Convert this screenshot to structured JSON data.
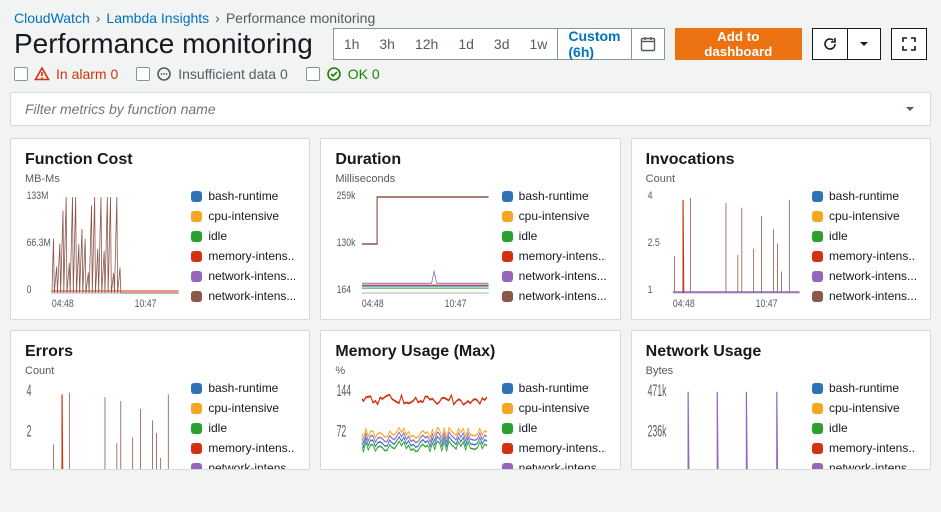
{
  "breadcrumbs": [
    "CloudWatch",
    "Lambda Insights",
    "Performance monitoring"
  ],
  "title": "Performance monitoring",
  "time_ranges": [
    "1h",
    "3h",
    "12h",
    "1d",
    "3d",
    "1w"
  ],
  "time_custom": "Custom (6h)",
  "add_dashboard": "Add to dashboard",
  "status": {
    "alarm_label": "In alarm 0",
    "insuff_label": "Insufficient data 0",
    "ok_label": "OK 0"
  },
  "filter_placeholder": "Filter metrics by function name",
  "legend_colors": {
    "bash-runtime": "#2e73b8",
    "cpu-intensive": "#f5a623",
    "idle": "#2ca02c",
    "memory-intens...": "#d13212",
    "network-intens...": "#9467bd",
    "network-intens... ": "#8c564b"
  },
  "x_ticks": [
    "04:48",
    "10:47"
  ],
  "cards": [
    {
      "title": "Function Cost",
      "unit": "MB-Ms",
      "yticks": [
        "133M",
        "66.3M",
        "0"
      ],
      "style": "spikes-brown"
    },
    {
      "title": "Duration",
      "unit": "Milliseconds",
      "yticks": [
        "259k",
        "130k",
        "164"
      ],
      "style": "step-brown-plus-low"
    },
    {
      "title": "Invocations",
      "unit": "Count",
      "yticks": [
        "4",
        "2.5",
        "1"
      ],
      "style": "spikes-brown-base"
    },
    {
      "title": "Errors",
      "unit": "Count",
      "yticks": [
        "4",
        "2",
        ""
      ],
      "style": "spikes-brown-cut"
    },
    {
      "title": "Memory Usage (Max)",
      "unit": "%",
      "yticks": [
        "144",
        "72",
        ""
      ],
      "style": "noisy-red-mid"
    },
    {
      "title": "Network Usage",
      "unit": "Bytes",
      "yticks": [
        "471k",
        "236k",
        ""
      ],
      "style": "spikes-purple"
    }
  ],
  "chart_data": [
    {
      "type": "line",
      "title": "Function Cost",
      "ylabel": "MB-Ms",
      "x_range": [
        "04:48",
        "10:47"
      ],
      "ylim": [
        0,
        133000000
      ],
      "series": [
        {
          "name": "bash-runtime",
          "note": "sparse low spikes",
          "approx_max": 5000000
        },
        {
          "name": "cpu-intensive",
          "note": "occasional spikes",
          "approx_max": 20000000
        },
        {
          "name": "idle",
          "note": "near zero"
        },
        {
          "name": "memory-intensive",
          "note": "sparse low spikes",
          "approx_max": 5000000
        },
        {
          "name": "network-intensive-a",
          "note": "dense spikes early",
          "approx_max": 130000000
        },
        {
          "name": "network-intensive-b",
          "note": "continuous low band",
          "approx_max": 3000000
        }
      ]
    },
    {
      "type": "line",
      "title": "Duration",
      "ylabel": "Milliseconds",
      "x_range": [
        "04:48",
        "10:47"
      ],
      "ylim": [
        164,
        259000
      ],
      "series": [
        {
          "name": "network-intensive-b",
          "note": "steps up to ~259k around 05:30 and stays",
          "approx_max": 259000
        },
        {
          "name": "bash-runtime",
          "note": "~3k steady"
        },
        {
          "name": "cpu-intensive",
          "note": "~4k steady"
        },
        {
          "name": "idle",
          "note": "~200 steady"
        },
        {
          "name": "memory-intensive",
          "note": "~3k with one spike ~20k"
        },
        {
          "name": "network-intensive-a",
          "note": "~5k steady"
        }
      ]
    },
    {
      "type": "line",
      "title": "Invocations",
      "ylabel": "Count",
      "x_range": [
        "04:48",
        "10:47"
      ],
      "ylim": [
        1,
        4
      ],
      "series": [
        {
          "name": "network-intensive-b",
          "note": "bursts to 4 periodically",
          "approx_max": 4
        },
        {
          "name": "memory-intensive",
          "note": "one spike to 4 then sits at 1"
        },
        {
          "name": "others",
          "note": "flat at 1"
        }
      ]
    },
    {
      "type": "line",
      "title": "Errors",
      "ylabel": "Count",
      "x_range": [
        "04:48",
        "10:47"
      ],
      "ylim": [
        0,
        4
      ],
      "series": [
        {
          "name": "network-intensive-b",
          "note": "bursts to 4 periodically"
        },
        {
          "name": "others",
          "note": "sparse/zero"
        }
      ]
    },
    {
      "type": "line",
      "title": "Memory Usage (Max)",
      "ylabel": "%",
      "x_range": [
        "04:48",
        "10:47"
      ],
      "ylim": [
        0,
        144
      ],
      "series": [
        {
          "name": "memory-intensive",
          "note": "noisy band ~130–144"
        },
        {
          "name": "bash-runtime",
          "note": "noisy band ~70–80"
        },
        {
          "name": "cpu-intensive",
          "note": "noisy band ~70–80"
        },
        {
          "name": "network-intensive-a",
          "note": "noisy band ~70–80"
        },
        {
          "name": "network-intensive-b",
          "note": "noisy band ~70–80"
        },
        {
          "name": "idle",
          "note": "~low"
        }
      ]
    },
    {
      "type": "line",
      "title": "Network Usage",
      "ylabel": "Bytes",
      "x_range": [
        "04:48",
        "10:47"
      ],
      "ylim": [
        0,
        471000
      ],
      "series": [
        {
          "name": "network-intensive-a",
          "note": "periodic spikes to ~471k"
        },
        {
          "name": "others",
          "note": "near zero"
        }
      ]
    }
  ]
}
